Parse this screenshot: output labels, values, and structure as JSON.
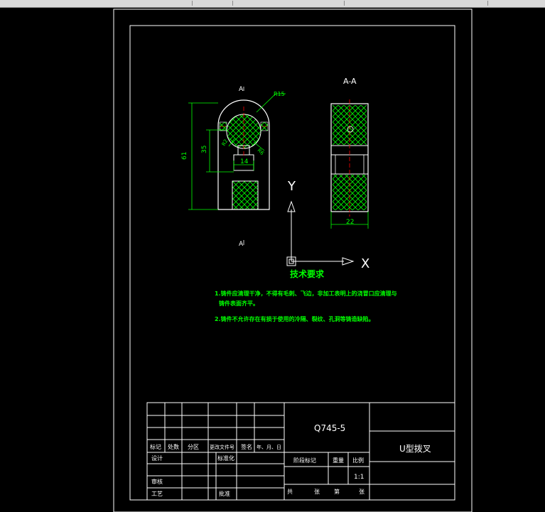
{
  "drawing": {
    "section_mark_top": "A",
    "section_mark_bottom": "A",
    "section_title": "A-A",
    "dim_radius": "R15",
    "dim_height_total": "61",
    "dim_height_inner": "35",
    "dim_slot_width": "14",
    "dim_small_1": "R2",
    "dim_small_2": "R6",
    "dim_thickness": "22",
    "ucs_y_label": "Y",
    "ucs_x_label": "X"
  },
  "tech_requirements": {
    "title": "技术要求",
    "line1": "1.铸件应清理干净，不得有毛刺、飞边，非加工表明上的浇冒口应清理与",
    "line2": "铸件表面齐平。",
    "line3": "2.铸件不允许存在有损于使用的冷隔、裂纹、孔洞等铸造缺陷。"
  },
  "title_block": {
    "material": "Q745-5",
    "part_name": "U型拨叉",
    "row_headers": [
      "标记",
      "处数",
      "分区",
      "更改文件号",
      "签名",
      "年、月、日"
    ],
    "design": "设计",
    "standardization": "标准化",
    "review": "审核",
    "process": "工艺",
    "approve": "批准",
    "stage_label": "阶段标记",
    "weight_label": "重量",
    "scale_label": "比例",
    "scale_value": "1:1",
    "sheet_total": "共",
    "sheet_unit": "张",
    "sheet_no": "第",
    "sheet_unit2": "张"
  },
  "colors": {
    "background": "#000000",
    "frame": "#ffffff",
    "dimension": "#00ff00",
    "text_green": "#00ff00",
    "hatch": "#00ff00",
    "center_line": "#ff0000"
  }
}
